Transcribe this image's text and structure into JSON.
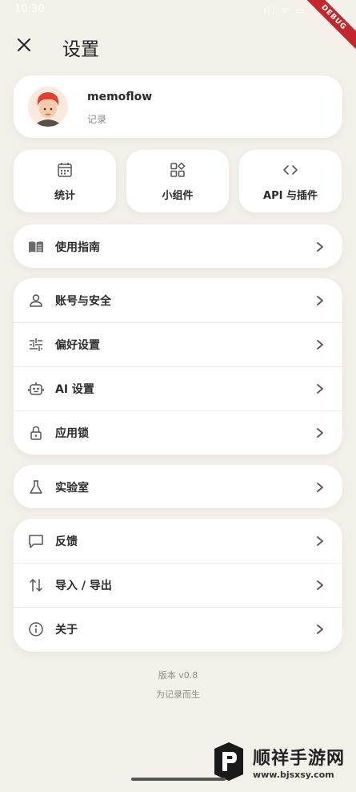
{
  "status_bar": {
    "time": "10:30",
    "icons": "ıll ᯤ ▭",
    "debug": "DEBUG"
  },
  "header": {
    "title": "设置"
  },
  "profile": {
    "name": "memoflow",
    "subtitle": "记录"
  },
  "quick_tiles": [
    {
      "label": "统计",
      "icon": "calendar-icon"
    },
    {
      "label": "小组件",
      "icon": "widgets-icon"
    },
    {
      "label": "API 与插件",
      "icon": "code-icon"
    }
  ],
  "sections": {
    "guide": [
      {
        "label": "使用指南",
        "icon": "book-icon"
      }
    ],
    "settings": [
      {
        "label": "账号与安全",
        "icon": "user-icon"
      },
      {
        "label": "偏好设置",
        "icon": "sliders-icon"
      },
      {
        "label": "AI 设置",
        "icon": "robot-icon"
      },
      {
        "label": "应用锁",
        "icon": "lock-icon"
      }
    ],
    "lab": [
      {
        "label": "实验室",
        "icon": "flask-icon"
      }
    ],
    "misc": [
      {
        "label": "反馈",
        "icon": "chat-bubble-icon"
      },
      {
        "label": "导入 / 导出",
        "icon": "import-export-icon"
      },
      {
        "label": "关于",
        "icon": "info-icon"
      }
    ]
  },
  "footer": {
    "version": "版本 v0.8",
    "tagline": "为记录而生"
  },
  "watermark": {
    "title": "顺祥手游网",
    "url": "www.bjsxsy.com"
  }
}
